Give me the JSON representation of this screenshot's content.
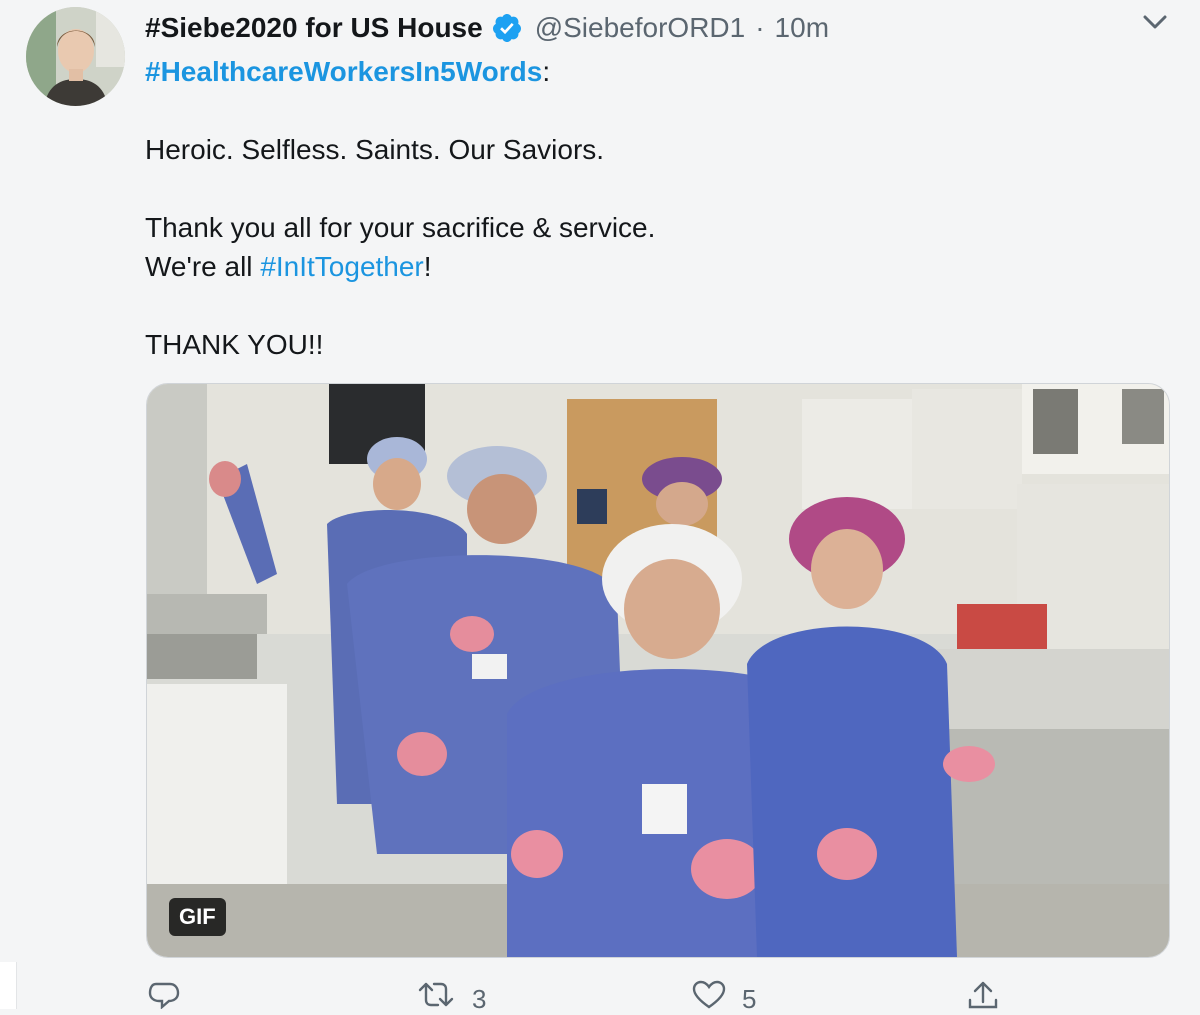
{
  "tweet": {
    "display_name": "#Siebe2020 for US House",
    "handle": "@SiebeforORD1",
    "separator": "·",
    "timestamp": "10m",
    "verified": true,
    "lines": {
      "hashtag_line": "#HealthcareWorkersIn5Words",
      "hashtag_line_suffix": ":",
      "line1": "Heroic. Selfless. Saints. Our Saviors.",
      "line2": "Thank you all for your sacrifice & service.",
      "line3_prefix": "We're all ",
      "line3_hashtag": "#InItTogether",
      "line3_suffix": "!",
      "line4": "THANK YOU!!"
    },
    "media": {
      "badge": "GIF"
    },
    "actions": {
      "reply_count": "",
      "retweet_count": "3",
      "like_count": "5",
      "share_count": ""
    }
  },
  "colors": {
    "link": "#1b95e0",
    "verified": "#1da1f2",
    "secondary_text": "#5b6670",
    "background": "#f4f5f6"
  },
  "icons": [
    "verified-badge-icon",
    "chevron-down-icon",
    "reply-icon",
    "retweet-icon",
    "like-icon",
    "share-icon"
  ]
}
